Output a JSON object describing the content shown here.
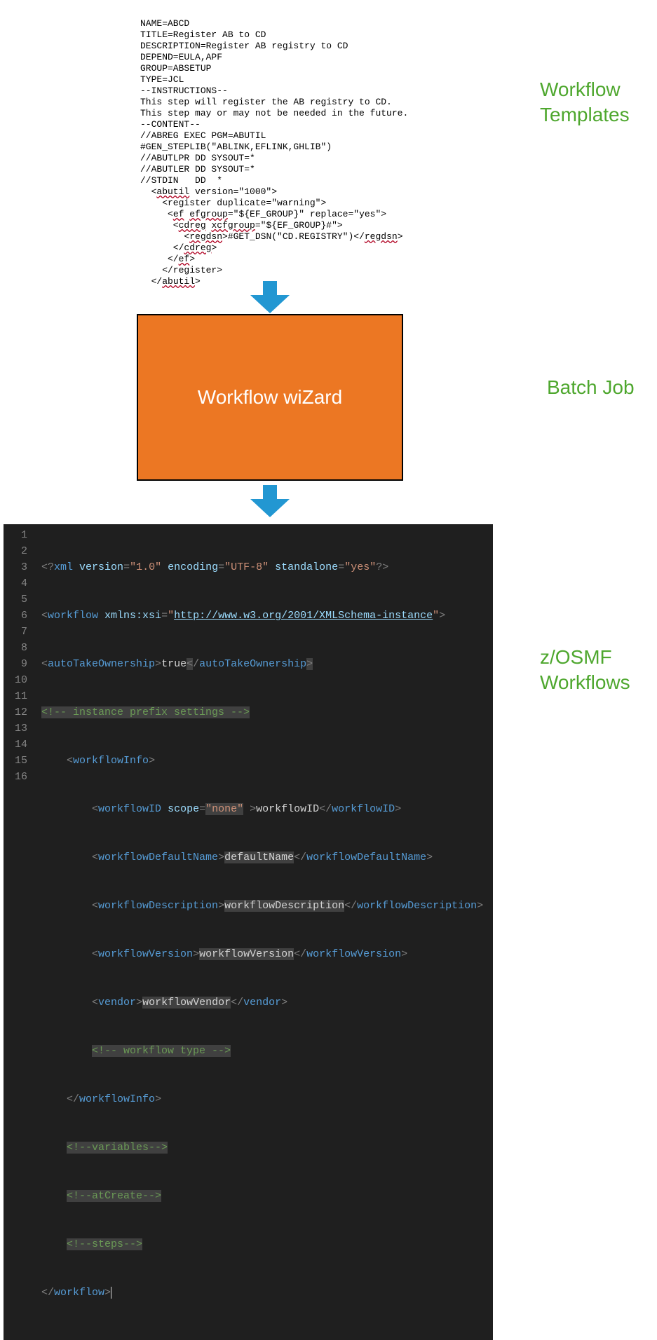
{
  "template": {
    "lines": [
      "NAME=ABCD",
      "TITLE=Register AB to CD",
      "DESCRIPTION=Register AB registry to CD",
      "DEPEND=EULA,APF",
      "GROUP=ABSETUP",
      "TYPE=JCL",
      "--INSTRUCTIONS--",
      "This step will register the AB registry to CD.",
      "This step may or may not be needed in the future.",
      "--CONTENT--",
      "//ABREG EXEC PGM=ABUTIL",
      "#GEN_STEPLIB(\"ABLINK,EFLINK,GHLIB\")",
      "//ABUTLPR DD SYSOUT=*",
      "//ABUTLER DD SYSOUT=*",
      "//STDIN   DD  *"
    ],
    "xml": {
      "l1a": "  <",
      "l1_tag": "abutil",
      "l1b": " version=\"1000\">",
      "l2": "    <register duplicate=\"warning\">",
      "l3a": "     <",
      "l3_t1": "ef",
      "l3b": " ",
      "l3_t2": "efgroup",
      "l3c": "=\"${EF_GROUP}\" replace=\"yes\">",
      "l4a": "      <",
      "l4_t1": "cdreg",
      "l4b": " ",
      "l4_t2": "xcfgroup",
      "l4c": "=\"${EF_GROUP}#\">",
      "l5a": "        <",
      "l5_t1": "regdsn",
      "l5b": ">#GET_DSN(\"CD.REGISTRY\")</",
      "l5_t2": "regdsn",
      "l5c": ">",
      "l6a": "      </",
      "l6_t": "cdreg",
      "l6b": ">",
      "l7a": "     </",
      "l7_t": "ef",
      "l7b": ">",
      "l8": "    </register>",
      "l9a": "  </",
      "l9_t": "abutil",
      "l9b": ">"
    }
  },
  "labels": {
    "top": "Workflow Templates",
    "mid": "Batch Job",
    "bot": "z/OSMF Workflows"
  },
  "wizard": {
    "title": "Workflow wiZard"
  },
  "editor": {
    "line_numbers": [
      "1",
      "2",
      "3",
      "4",
      "5",
      "6",
      "7",
      "8",
      "9",
      "10",
      "11",
      "12",
      "13",
      "14",
      "15",
      "16"
    ],
    "l1": {
      "pre": "<?",
      "tag": "xml",
      "a1": "version",
      "v1": "\"1.0\"",
      "a2": "encoding",
      "v2": "\"UTF-8\"",
      "a3": "standalone",
      "v3": "\"yes\"",
      "post": "?>"
    },
    "l2": {
      "tag": "workflow",
      "attr": "xmlns:xsi",
      "url": "http://www.w3.org/2001/XMLSchema-instance"
    },
    "l3": {
      "tag": "autoTakeOwnership",
      "text": "true"
    },
    "l4": {
      "comment": "<!-- instance prefix settings -->"
    },
    "l5": {
      "tag": "workflowInfo"
    },
    "l6": {
      "tag": "workflowID",
      "attr": "scope",
      "val": "\"none\"",
      "text": "workflowID"
    },
    "l7": {
      "tag": "workflowDefaultName",
      "text": "defaultName"
    },
    "l8": {
      "tag": "workflowDescription",
      "text": "workflowDescription"
    },
    "l9": {
      "tag": "workflowVersion",
      "text": "workflowVersion"
    },
    "l10": {
      "tag": "vendor",
      "text": "workflowVendor"
    },
    "l11": {
      "comment": "<!-- workflow type -->"
    },
    "l12": {
      "tag": "workflowInfo"
    },
    "l13": {
      "comment": "<!--variables-->"
    },
    "l14": {
      "comment": "<!--atCreate-->"
    },
    "l15": {
      "comment": "<!--steps-->"
    },
    "l16": {
      "tag": "workflow"
    }
  }
}
